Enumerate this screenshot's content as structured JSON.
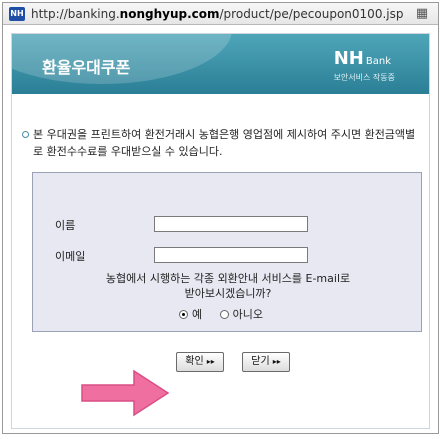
{
  "browser": {
    "site_icon": "NH",
    "url_prefix": "http://banking.",
    "url_domain": "nonghyup.com",
    "url_path": "/product/pe/pecoupon0100.jsp",
    "action_icon": "page-action-icon"
  },
  "header": {
    "title": "환율우대쿠폰",
    "logo_main": "NH",
    "logo_bank": "Bank",
    "logo_sub": "보안서비스 작동중"
  },
  "notice": {
    "text": "본 우대권을 프린트하여 환전거래시 농협은행 영업점에 제시하여 주시면 환전금액별로 환전수수료를 우대받으실 수 있습니다."
  },
  "form": {
    "name_label": "이름",
    "name_value": "",
    "email_label": "이메일",
    "email_value": "",
    "question_line1": "농협에서 시행하는 각종 외환안내 서비스를 E-mail로",
    "question_line2": "받아보시겠습니까?",
    "yes_label": "예",
    "no_label": "아니오",
    "selected": "예"
  },
  "buttons": {
    "confirm_label": "확인",
    "close_label": "닫기"
  },
  "colors": {
    "header_gradient_top": "#4fa5b8",
    "header_gradient_bottom": "#2a7f96",
    "form_bg": "#e8e8f2",
    "arrow_pink": "#f06fa1"
  }
}
